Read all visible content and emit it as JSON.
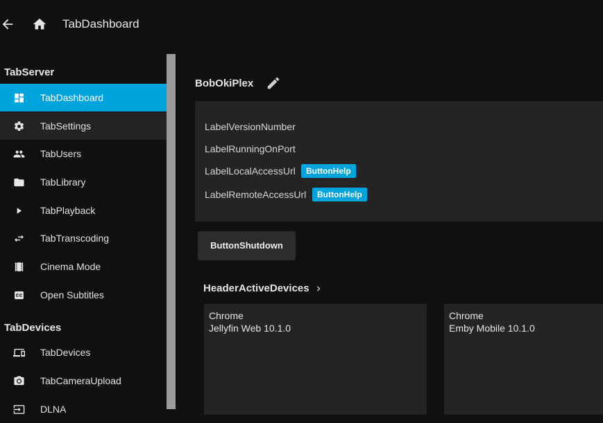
{
  "topbar": {
    "title": "TabDashboard"
  },
  "sidebar": {
    "sections": [
      {
        "header": "TabServer"
      },
      {
        "header": "TabDevices"
      }
    ],
    "server_items": [
      {
        "label": "TabDashboard",
        "icon": "dashboard-icon"
      },
      {
        "label": "TabSettings",
        "icon": "gear-icon"
      },
      {
        "label": "TabUsers",
        "icon": "users-icon"
      },
      {
        "label": "TabLibrary",
        "icon": "folder-icon"
      },
      {
        "label": "TabPlayback",
        "icon": "play-icon"
      },
      {
        "label": "TabTranscoding",
        "icon": "swap-icon"
      },
      {
        "label": "Cinema Mode",
        "icon": "film-icon"
      },
      {
        "label": "Open Subtitles",
        "icon": "subtitles-icon"
      }
    ],
    "device_items": [
      {
        "label": "TabDevices",
        "icon": "devices-icon"
      },
      {
        "label": "TabCameraUpload",
        "icon": "camera-icon"
      },
      {
        "label": "DLNA",
        "icon": "input-icon"
      }
    ]
  },
  "main": {
    "server_name": "BobOkiPlex",
    "info": {
      "version_label": "LabelVersionNumber",
      "port_label": "LabelRunningOnPort",
      "local_label": "LabelLocalAccessUrl",
      "remote_label": "LabelRemoteAccessUrl",
      "help_label": "ButtonHelp"
    },
    "shutdown_label": "ButtonShutdown",
    "devices_header": "HeaderActiveDevices",
    "devices": [
      {
        "client": "Chrome",
        "app": "Jellyfin Web 10.1.0"
      },
      {
        "client": "Chrome",
        "app": "Emby Mobile 10.1.0"
      }
    ]
  },
  "colors": {
    "accent": "#00a4dc",
    "background": "#101010",
    "panel": "#242424"
  }
}
